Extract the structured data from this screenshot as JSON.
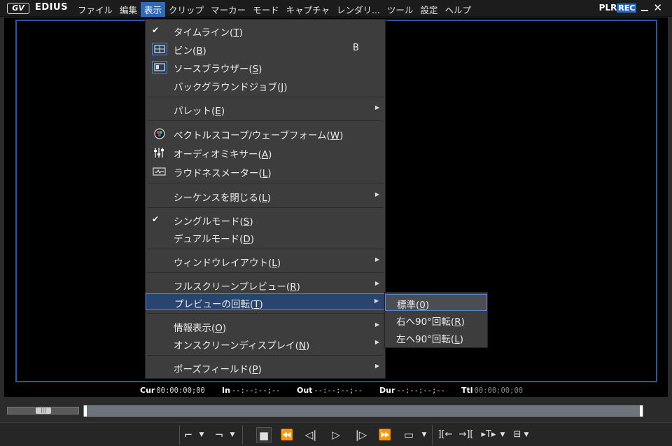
{
  "app": {
    "logo_text": "GV",
    "name": "EDIUS"
  },
  "menubar": [
    {
      "label": "ファイル"
    },
    {
      "label": "編集"
    },
    {
      "label": "表示"
    },
    {
      "label": "クリップ"
    },
    {
      "label": "マーカー"
    },
    {
      "label": "モード"
    },
    {
      "label": "キャプチャ"
    },
    {
      "label": "レンダリ..."
    },
    {
      "label": "ツール"
    },
    {
      "label": "設定"
    },
    {
      "label": "ヘルプ"
    }
  ],
  "mode": {
    "plr": "PLR",
    "rec": "REC"
  },
  "view_menu": {
    "items": [
      {
        "label": "タイムライン(",
        "key": "T",
        "tail": ")",
        "checked": true
      },
      {
        "label": "ビン(",
        "key": "B",
        "tail": ")",
        "shortcut": "B",
        "icon": "bin-icon"
      },
      {
        "label": "ソースブラウザー(",
        "key": "S",
        "tail": ")",
        "icon": "source-browser-icon"
      },
      {
        "label": "バックグラウンドジョブ(",
        "key": "J",
        "tail": ")"
      },
      {
        "label": "パレット(",
        "key": "E",
        "tail": ")",
        "submenu": true
      },
      {
        "label": "ベクトルスコープ/ウェーブフォーム(",
        "key": "W",
        "tail": ")",
        "icon": "vectorscope-icon"
      },
      {
        "label": "オーディオミキサー(",
        "key": "A",
        "tail": ")",
        "icon": "audio-mixer-icon"
      },
      {
        "label": "ラウドネスメーター(",
        "key": "L",
        "tail": ")",
        "icon": "loudness-meter-icon"
      },
      {
        "label": "シーケンスを閉じる(",
        "key": "L",
        "tail": ")",
        "submenu": true
      },
      {
        "label": "シングルモード(",
        "key": "S",
        "tail": ")",
        "checked": true
      },
      {
        "label": "デュアルモード(",
        "key": "D",
        "tail": ")"
      },
      {
        "label": "ウィンドウレイアウト(",
        "key": "L",
        "tail": ")",
        "submenu": true
      },
      {
        "label": "フルスクリーンプレビュー(",
        "key": "R",
        "tail": ")",
        "submenu": true
      },
      {
        "label": "プレビューの回転(",
        "key": "T",
        "tail": ")",
        "submenu": true,
        "highlighted": true
      },
      {
        "label": "情報表示(",
        "key": "O",
        "tail": ")",
        "submenu": true
      },
      {
        "label": "オンスクリーンディスプレイ(",
        "key": "N",
        "tail": ")",
        "submenu": true
      },
      {
        "label": "ポーズフィールド(",
        "key": "P",
        "tail": ")",
        "submenu": true
      }
    ]
  },
  "rotation_submenu": {
    "items": [
      {
        "label": "標準(",
        "key": "0",
        "tail": ")",
        "highlighted": true
      },
      {
        "label": "右へ90°回転(",
        "key": "R",
        "tail": ")"
      },
      {
        "label": "左へ90°回転(",
        "key": "L",
        "tail": ")"
      }
    ]
  },
  "timecodes": {
    "cur": {
      "label": "Cur",
      "value": "00:00:00;00"
    },
    "in": {
      "label": "In",
      "value": "--:--:--;--"
    },
    "out": {
      "label": "Out",
      "value": "--:--:--;--"
    },
    "dur": {
      "label": "Dur",
      "value": "--:--:--;--"
    },
    "ttl": {
      "label": "Ttl",
      "value": "00:00:00;00"
    }
  },
  "colors": {
    "accent": "#2f6ab8",
    "safe_frame": "#2b55a8",
    "menu_bg": "#3d3d3d"
  }
}
